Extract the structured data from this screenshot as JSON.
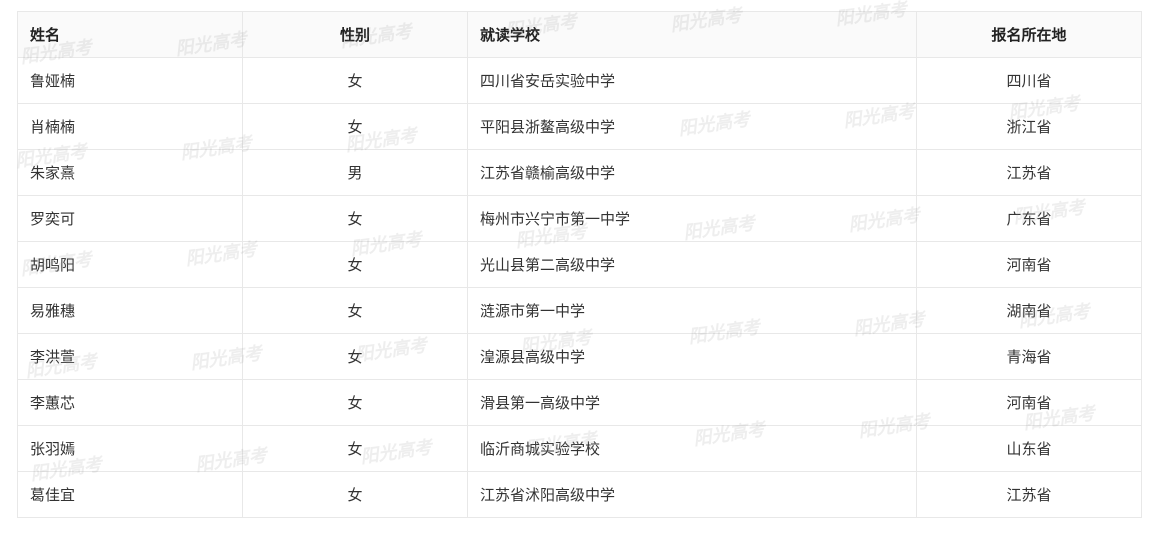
{
  "table": {
    "headers": [
      "姓名",
      "性别",
      "就读学校",
      "报名所在地"
    ],
    "rows": [
      [
        "鲁娅楠",
        "女",
        "四川省安岳实验中学",
        "四川省"
      ],
      [
        "肖楠楠",
        "女",
        "平阳县浙鳌高级中学",
        "浙江省"
      ],
      [
        "朱家熹",
        "男",
        "江苏省赣榆高级中学",
        "江苏省"
      ],
      [
        "罗奕可",
        "女",
        "梅州市兴宁市第一中学",
        "广东省"
      ],
      [
        "胡鸣阳",
        "女",
        "光山县第二高级中学",
        "河南省"
      ],
      [
        "易雅穗",
        "女",
        "涟源市第一中学",
        "湖南省"
      ],
      [
        "李洪萱",
        "女",
        "湟源县高级中学",
        "青海省"
      ],
      [
        "李蕙芯",
        "女",
        "滑县第一高级中学",
        "河南省"
      ],
      [
        "张羽嫣",
        "女",
        "临沂商城实验学校",
        "山东省"
      ],
      [
        "葛佳宜",
        "女",
        "江苏省沭阳高级中学",
        "江苏省"
      ]
    ]
  },
  "watermark": {
    "text": "阳光高考",
    "color": "#969696"
  }
}
